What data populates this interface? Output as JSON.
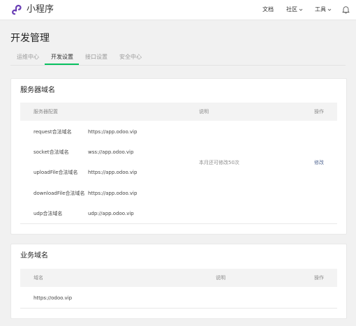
{
  "app": {
    "brand": "小程序"
  },
  "topnav": {
    "docs": "文档",
    "community": "社区",
    "tools": "工具"
  },
  "page": {
    "title": "开发管理"
  },
  "tabs": [
    {
      "label": "运维中心",
      "active": false
    },
    {
      "label": "开发设置",
      "active": true
    },
    {
      "label": "接口设置",
      "active": false
    },
    {
      "label": "安全中心",
      "active": false
    }
  ],
  "server_domains": {
    "title": "服务器域名",
    "headers": {
      "config": "服务器配置",
      "desc": "说明",
      "action": "操作"
    },
    "rows": [
      {
        "name": "request合法域名",
        "value": "https://app.odoo.vip"
      },
      {
        "name": "socket合法域名",
        "value": "wss://app.odoo.vip"
      },
      {
        "name": "uploadFile合法域名",
        "value": "https://app.odoo.vip"
      },
      {
        "name": "downloadFile合法域名",
        "value": "https://app.odoo.vip"
      },
      {
        "name": "udp合法域名",
        "value": "udp://app.odoo.vip"
      }
    ],
    "note": "本月还可修改50次",
    "action_label": "修改"
  },
  "business_domains": {
    "title": "业务域名",
    "headers": {
      "domain": "域名",
      "desc": "说明",
      "action": "操作"
    },
    "rows": [
      {
        "value": "https://odoo.vip"
      }
    ]
  },
  "colors": {
    "accent": "#07c160",
    "link": "#576b95",
    "logo": "#6a3fb5"
  }
}
